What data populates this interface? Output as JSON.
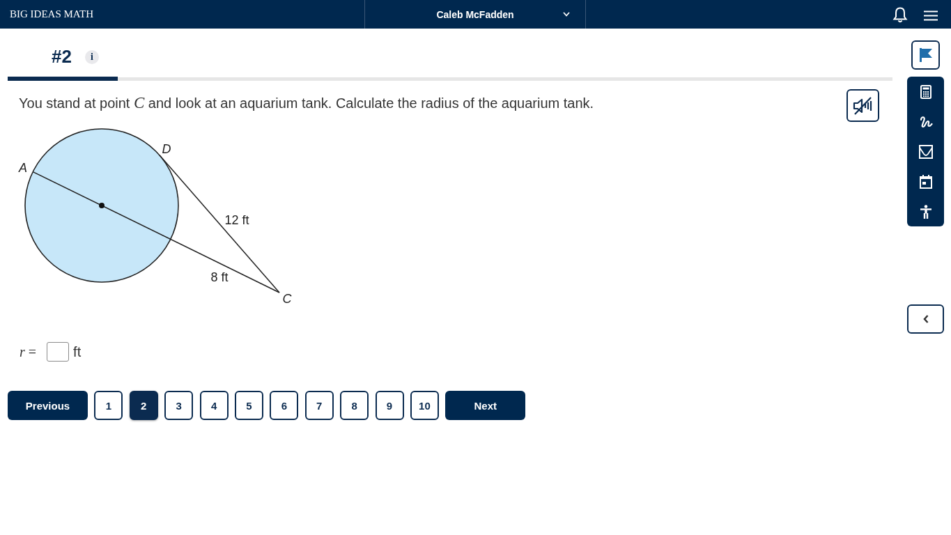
{
  "top_bar": {
    "brand": "BIG IDEAS MATH",
    "user_name": "Caleb McFadden"
  },
  "tabs": [
    {
      "label": "#2",
      "info": "i",
      "selected": true
    }
  ],
  "question": {
    "prompt": "You stand at point *C* and look at an aquarium tank. Calculate the radius of the aquarium tank.",
    "diagram": {
      "points": [
        {
          "label": "A"
        },
        {
          "label": "D"
        },
        {
          "label": "C"
        }
      ],
      "lengths": [
        {
          "label": "12 ft"
        },
        {
          "label": "8 ft"
        }
      ]
    },
    "answer": {
      "variable": "*r* =",
      "unit": "ft"
    }
  },
  "pagination": {
    "previous": "Previous",
    "pages": [
      {
        "label": "1",
        "selected": false
      },
      {
        "label": "2",
        "selected": true
      },
      {
        "label": "3",
        "selected": false
      },
      {
        "label": "4",
        "selected": false
      },
      {
        "label": "5",
        "selected": false
      },
      {
        "label": "6",
        "selected": false
      },
      {
        "label": "7",
        "selected": false
      },
      {
        "label": "8",
        "selected": false
      },
      {
        "label": "9",
        "selected": false
      },
      {
        "label": "10",
        "selected": false
      }
    ],
    "next": "Next"
  }
}
